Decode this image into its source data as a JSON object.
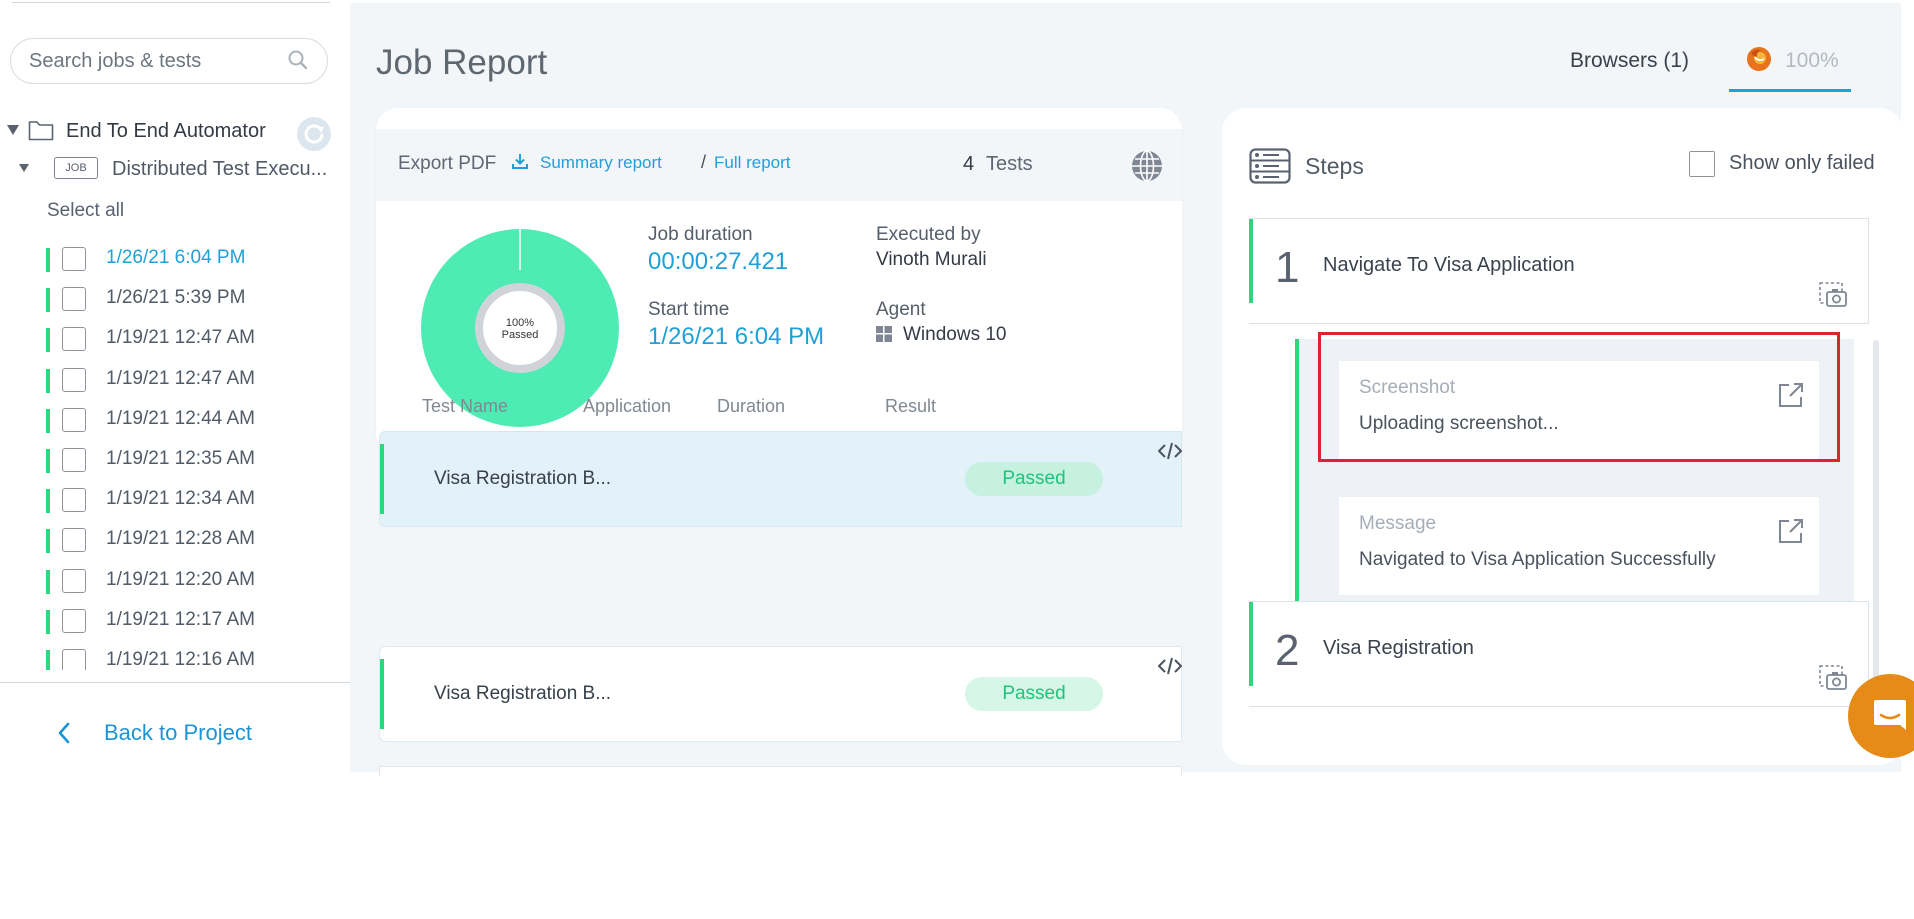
{
  "sidebar": {
    "search": {
      "placeholder": "Search jobs & tests",
      "value": ""
    },
    "project": {
      "label": "End To End Automator"
    },
    "job": {
      "badge": "JOB",
      "label": "Distributed Test Execu..."
    },
    "select_all": "Select all",
    "runs": [
      {
        "date": "1/26/21 6:04 PM",
        "active": true
      },
      {
        "date": "1/26/21 5:39 PM"
      },
      {
        "date": "1/19/21 12:47 AM"
      },
      {
        "date": "1/19/21 12:47 AM"
      },
      {
        "date": "1/19/21 12:44 AM"
      },
      {
        "date": "1/19/21 12:35 AM"
      },
      {
        "date": "1/19/21 12:34 AM"
      },
      {
        "date": "1/19/21 12:28 AM"
      },
      {
        "date": "1/19/21 12:20 AM"
      },
      {
        "date": "1/19/21 12:17 AM"
      },
      {
        "date": "1/19/21 12:16 AM"
      }
    ],
    "back_label": "Back to Project"
  },
  "header": {
    "title": "Job Report",
    "browsers_label": "Browsers (1)",
    "browser_percent": "100%"
  },
  "summary": {
    "export_label": "Export PDF",
    "summary_link": "Summary report",
    "separator": "/",
    "full_link": "Full report",
    "tests_count": "4",
    "tests_label": "Tests",
    "donut_percent": "100%",
    "donut_status": "Passed",
    "passed_fraction": 1.0,
    "job_duration_label": "Job duration",
    "job_duration": "00:00:27.421",
    "executed_by_label": "Executed by",
    "executed_by": "Vinoth Murali",
    "start_time_label": "Start time",
    "start_time": "1/26/21 6:04 PM",
    "agent_label": "Agent",
    "agent": "Windows 10"
  },
  "table": {
    "headers": [
      "Test Name",
      "Application",
      "Duration",
      "Result"
    ],
    "rows": [
      {
        "name": "Visa Registration B...",
        "result": "Passed",
        "selected": true
      },
      {
        "name": "Visa Registration B...",
        "result": "Passed",
        "selected": false
      }
    ]
  },
  "steps": {
    "title": "Steps",
    "show_failed_label": "Show only failed",
    "items": [
      {
        "number": "1",
        "title": "Navigate To Visa Application"
      },
      {
        "number": "2",
        "title": "Visa Registration"
      }
    ],
    "details": [
      {
        "key": "Screenshot",
        "value": "Uploading screenshot..."
      },
      {
        "key": "Message",
        "value": "Navigated to Visa Application Successfully"
      }
    ]
  },
  "colors": {
    "accent_blue": "#1fa0d9",
    "pass_green": "#2dd77d",
    "donut_green": "#4eecb4",
    "highlight_red": "#dc2626",
    "chat_orange": "#e68b17"
  },
  "icons": [
    "search-icon",
    "caret-down-icon",
    "folder-icon",
    "refresh-icon",
    "chevron-left-icon",
    "firefox-icon",
    "download-icon",
    "globe-icon",
    "windows-icon",
    "code-icon",
    "steps-list-icon",
    "camera-icon",
    "open-external-icon",
    "chat-icon"
  ]
}
